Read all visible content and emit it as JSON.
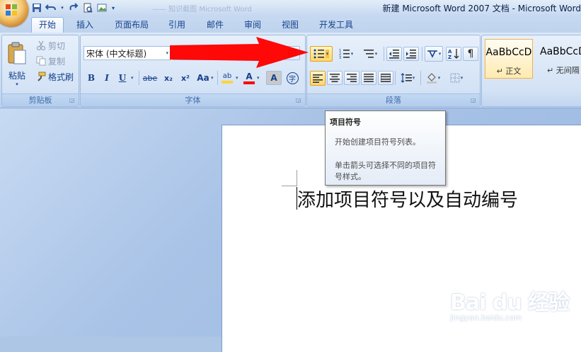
{
  "title_bar": {
    "title": "新建 Microsoft Word 2007 文档 - Microsoft Word",
    "faded_title": "—— 知识截图  Microsoft Word"
  },
  "tabs": [
    "开始",
    "插入",
    "页面布局",
    "引用",
    "邮件",
    "审阅",
    "视图",
    "开发工具"
  ],
  "active_tab": "开始",
  "clipboard": {
    "paste_label": "粘贴",
    "cut_label": "剪切",
    "copy_label": "复制",
    "format_painter_label": "格式刷",
    "group_label": "剪贴板"
  },
  "font": {
    "font_name": "宋体 (中文标题)",
    "bold": "B",
    "italic": "I",
    "underline": "U",
    "strike": "abe",
    "subscript": "x₂",
    "superscript": "x²",
    "change_case": "Aa",
    "highlight": "ab",
    "font_color": "A",
    "char_shading": "A",
    "enclose": "字",
    "group_label": "字体"
  },
  "paragraph": {
    "group_label": "段落"
  },
  "styles": {
    "items": [
      {
        "preview": "AaBbCcD",
        "name": "↵ 正文"
      },
      {
        "preview": "AaBbCcD",
        "name": "↵ 无间隔"
      }
    ]
  },
  "tooltip": {
    "title": "项目符号",
    "description": "开始创建项目符号列表。",
    "hint": "单击箭头可选择不同的项目符号样式。"
  },
  "document": {
    "text": "添加项目符号以及自动编号"
  },
  "watermark": {
    "brand": "Bai du 经验",
    "url": "jingyan.baidu.com"
  },
  "colors": {
    "accent": "#15428b",
    "arrow": "#ff0000",
    "highlight_yellow": "#ffd43a"
  }
}
